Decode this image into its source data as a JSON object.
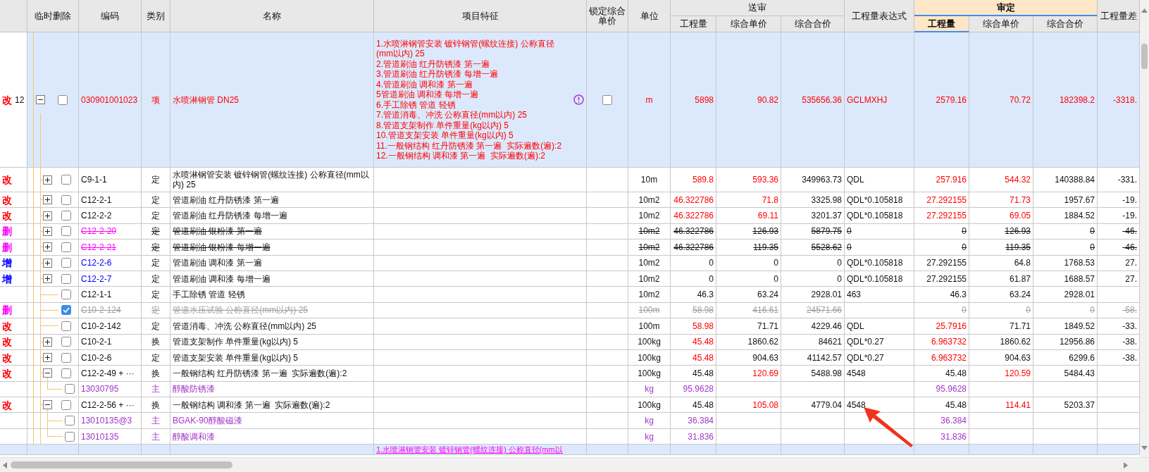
{
  "columns": [
    {
      "selected": false
    },
    {
      "label": "临时删除",
      "selected": false
    },
    {
      "label": "编码",
      "selected": false
    },
    {
      "label": "类别",
      "selected": false
    },
    {
      "label": "名称",
      "selected": false
    },
    {
      "label": "项目特征",
      "selected": false
    },
    {
      "label": "锁定综合单价",
      "selected": false
    },
    {
      "label": "单位",
      "selected": false
    },
    {
      "label": "送审",
      "selected": false,
      "children": [
        {
          "label": "工程量",
          "selected": false
        },
        {
          "label": "综合单价",
          "selected": false
        },
        {
          "label": "综合合价",
          "selected": false
        }
      ]
    },
    {
      "label": "工程量表达式",
      "selected": false
    },
    {
      "label": "审定",
      "selected": true,
      "children": [
        {
          "label": "工程量",
          "selected": true
        },
        {
          "label": "综合单价",
          "selected": false
        },
        {
          "label": "综合合价",
          "selected": false
        }
      ]
    },
    {
      "label": "工程量差",
      "selected": false
    }
  ],
  "rows": [
    {
      "kind": "item",
      "status": {
        "text": "改",
        "color": "#ff0000"
      },
      "line_no": "12",
      "expanded": true,
      "checked": false,
      "struck": false,
      "code": "030901001023",
      "type": "项",
      "name": "水喷淋钢管 DN25",
      "features": [
        "1.水喷淋钢管安装 镀锌钢管(螺纹连接) 公称直径(mm以内) 25",
        "2.管道刷油 红丹防锈漆 第一遍",
        "3.管道刷油 红丹防锈漆 每增一遍",
        "4.管道刷油 调和漆 第一遍",
        "5管道刷油 调和漆 每增一遍",
        "6.手工除锈 管道 轻锈",
        "7.管道消毒、冲洗 公称直径(mm以内) 25",
        "8.管道支架制作 单件重量(kg以内) 5",
        "10.管道支架安装 单件重量(kg以内) 5",
        "11.一般钢结构 红丹防锈漆 第一遍  实际遍数(遍):2",
        "12.一般钢结构 调和漆 第一遍  实际遍数(遍):2"
      ],
      "warning": true,
      "locked": false,
      "unit": "m",
      "sub_qty": {
        "text": "5898",
        "changed": true
      },
      "sub_price": {
        "text": "90.82",
        "changed": true
      },
      "sub_total": {
        "text": "535656.36",
        "changed": true
      },
      "expression": {
        "text": "GCLMXHJ",
        "changed": true
      },
      "app_qty": {
        "text": "2579.16",
        "changed": true
      },
      "app_price": {
        "text": "70.72",
        "changed": true
      },
      "app_total": {
        "text": "182398.2",
        "changed": true
      },
      "diff": {
        "text": "-3318.",
        "changed": true
      },
      "children": [
        {
          "kind": "quota",
          "status": {
            "text": "改",
            "color": "#ff0000"
          },
          "expanded": false,
          "checked": false,
          "struck": false,
          "code": "C9-1-1",
          "type": "定",
          "name": "水喷淋钢管安装 镀锌钢管(螺纹连接) 公称直径(mm以内) 25",
          "unit": "10m",
          "sub_qty": {
            "text": "589.8",
            "changed": true
          },
          "sub_price": {
            "text": "593.36",
            "changed": true
          },
          "sub_total": {
            "text": "349963.73",
            "changed": false
          },
          "expression": {
            "text": "QDL",
            "changed": false
          },
          "app_qty": {
            "text": "257.916",
            "changed": true
          },
          "app_price": {
            "text": "544.32",
            "changed": true
          },
          "app_total": {
            "text": "140388.84",
            "changed": false
          },
          "diff": {
            "text": "-331.",
            "changed": false
          }
        },
        {
          "kind": "quota",
          "status": {
            "text": "改",
            "color": "#ff0000"
          },
          "expanded": false,
          "checked": false,
          "struck": false,
          "code": "C12-2-1",
          "type": "定",
          "name": "管道刷油 红丹防锈漆 第一遍",
          "unit": "10m2",
          "sub_qty": {
            "text": "46.322786",
            "changed": true
          },
          "sub_price": {
            "text": "71.8",
            "changed": true
          },
          "sub_total": {
            "text": "3325.98",
            "changed": false
          },
          "expression": {
            "text": "QDL*0.105818",
            "changed": false
          },
          "app_qty": {
            "text": "27.292155",
            "changed": true
          },
          "app_price": {
            "text": "71.73",
            "changed": true
          },
          "app_total": {
            "text": "1957.67",
            "changed": false
          },
          "diff": {
            "text": "-19.",
            "changed": false
          }
        },
        {
          "kind": "quota",
          "status": {
            "text": "改",
            "color": "#ff0000"
          },
          "expanded": false,
          "checked": false,
          "struck": false,
          "code": "C12-2-2",
          "type": "定",
          "name": "管道刷油 红丹防锈漆 每增一遍",
          "unit": "10m2",
          "sub_qty": {
            "text": "46.322786",
            "changed": true
          },
          "sub_price": {
            "text": "69.11",
            "changed": true
          },
          "sub_total": {
            "text": "3201.37",
            "changed": false
          },
          "expression": {
            "text": "QDL*0.105818",
            "changed": false
          },
          "app_qty": {
            "text": "27.292155",
            "changed": true
          },
          "app_price": {
            "text": "69.05",
            "changed": true
          },
          "app_total": {
            "text": "1884.52",
            "changed": false
          },
          "diff": {
            "text": "-19.",
            "changed": false
          }
        },
        {
          "kind": "quota",
          "status": {
            "text": "删",
            "color": "#ff00ff"
          },
          "expanded": false,
          "checked": false,
          "struck": true,
          "code": {
            "text": "C12-2-20",
            "color": "#ff00ff"
          },
          "type": "定",
          "name": "管道刷油 银粉漆 第一遍",
          "unit": "10m2",
          "sub_qty": {
            "text": "46.322786",
            "changed": false
          },
          "sub_price": {
            "text": "126.93",
            "changed": false
          },
          "sub_total": {
            "text": "5879.75",
            "changed": false
          },
          "expression": {
            "text": "0",
            "changed": false
          },
          "app_qty": {
            "text": "0",
            "changed": false
          },
          "app_price": {
            "text": "126.93",
            "changed": false
          },
          "app_total": {
            "text": "0",
            "changed": false
          },
          "diff": {
            "text": "-46.",
            "changed": false
          }
        },
        {
          "kind": "quota",
          "status": {
            "text": "删",
            "color": "#ff00ff"
          },
          "expanded": false,
          "checked": false,
          "struck": true,
          "code": {
            "text": "C12-2-21",
            "color": "#ff00ff"
          },
          "type": "定",
          "name": "管道刷油 银粉漆 每增一遍",
          "unit": "10m2",
          "sub_qty": {
            "text": "46.322786",
            "changed": false
          },
          "sub_price": {
            "text": "119.35",
            "changed": false
          },
          "sub_total": {
            "text": "5528.62",
            "changed": false
          },
          "expression": {
            "text": "0",
            "changed": false
          },
          "app_qty": {
            "text": "0",
            "changed": false
          },
          "app_price": {
            "text": "119.35",
            "changed": false
          },
          "app_total": {
            "text": "0",
            "changed": false
          },
          "diff": {
            "text": "-46.",
            "changed": false
          }
        },
        {
          "kind": "quota",
          "status": {
            "text": "增",
            "color": "#0000ff"
          },
          "expanded": false,
          "checked": false,
          "struck": false,
          "code": {
            "text": "C12-2-6",
            "color": "#0000ff"
          },
          "type": "定",
          "name": "管道刷油 调和漆 第一遍",
          "unit": "10m2",
          "sub_qty": {
            "text": "0",
            "changed": false
          },
          "sub_price": {
            "text": "0",
            "changed": false
          },
          "sub_total": {
            "text": "0",
            "changed": false
          },
          "expression": {
            "text": "QDL*0.105818",
            "changed": false
          },
          "app_qty": {
            "text": "27.292155",
            "changed": false
          },
          "app_price": {
            "text": "64.8",
            "changed": false
          },
          "app_total": {
            "text": "1768.53",
            "changed": false
          },
          "diff": {
            "text": "27.",
            "changed": false
          }
        },
        {
          "kind": "quota",
          "status": {
            "text": "增",
            "color": "#0000ff"
          },
          "expanded": false,
          "checked": false,
          "struck": false,
          "code": {
            "text": "C12-2-7",
            "color": "#0000ff"
          },
          "type": "定",
          "name": "管道刷油 调和漆 每增一遍",
          "unit": "10m2",
          "sub_qty": {
            "text": "0",
            "changed": false
          },
          "sub_price": {
            "text": "0",
            "changed": false
          },
          "sub_total": {
            "text": "0",
            "changed": false
          },
          "expression": {
            "text": "QDL*0.105818",
            "changed": false
          },
          "app_qty": {
            "text": "27.292155",
            "changed": false
          },
          "app_price": {
            "text": "61.87",
            "changed": false
          },
          "app_total": {
            "text": "1688.57",
            "changed": false
          },
          "diff": {
            "text": "27.",
            "changed": false
          }
        },
        {
          "kind": "quota",
          "checked": false,
          "struck": false,
          "code": "C12-1-1",
          "type": "定",
          "name": "手工除锈 管道 轻锈",
          "unit": "10m2",
          "sub_qty": {
            "text": "46.3",
            "changed": false
          },
          "sub_price": {
            "text": "63.24",
            "changed": false
          },
          "sub_total": {
            "text": "2928.01",
            "changed": false
          },
          "expression": {
            "text": "463",
            "changed": false
          },
          "app_qty": {
            "text": "46.3",
            "changed": false
          },
          "app_price": {
            "text": "63.24",
            "changed": false
          },
          "app_total": {
            "text": "2928.01",
            "changed": false
          }
        },
        {
          "kind": "quota",
          "status": {
            "text": "删",
            "color": "#ff00ff"
          },
          "checked": true,
          "struck": true,
          "code": "C10-2-124",
          "type": "定",
          "name": "管道水压试验 公称直径(mm以内) 25",
          "unit": "100m",
          "sub_qty": {
            "text": "58.98",
            "changed": false
          },
          "sub_price": {
            "text": "416.61",
            "changed": false
          },
          "sub_total": {
            "text": "24571.66",
            "changed": false
          },
          "app_qty": {
            "text": "0",
            "changed": false
          },
          "app_price": {
            "text": "0",
            "changed": false
          },
          "app_total": {
            "text": "0",
            "changed": false
          },
          "diff": {
            "text": "-58.",
            "changed": false
          }
        },
        {
          "kind": "quota",
          "status": {
            "text": "改",
            "color": "#ff0000"
          },
          "checked": false,
          "struck": false,
          "code": "C10-2-142",
          "type": "定",
          "name": "管道消毒、冲洗 公称直径(mm以内) 25",
          "unit": "100m",
          "sub_qty": {
            "text": "58.98",
            "changed": true
          },
          "sub_price": {
            "text": "71.71",
            "changed": false
          },
          "sub_total": {
            "text": "4229.46",
            "changed": false
          },
          "expression": {
            "text": "QDL",
            "changed": false
          },
          "app_qty": {
            "text": "25.7916",
            "changed": true
          },
          "app_price": {
            "text": "71.71",
            "changed": false
          },
          "app_total": {
            "text": "1849.52",
            "changed": false
          },
          "diff": {
            "text": "-33.",
            "changed": false
          }
        },
        {
          "kind": "quota",
          "status": {
            "text": "改",
            "color": "#ff0000"
          },
          "expanded": false,
          "checked": false,
          "struck": false,
          "code": "C10-2-1",
          "type": "换",
          "name": "管道支架制作 单件重量(kg以内) 5",
          "unit": "100kg",
          "sub_qty": {
            "text": "45.48",
            "changed": true
          },
          "sub_price": {
            "text": "1860.62",
            "changed": false
          },
          "sub_total": {
            "text": "84621",
            "changed": false
          },
          "expression": {
            "text": "QDL*0.27",
            "changed": false
          },
          "app_qty": {
            "text": "6.963732",
            "changed": true
          },
          "app_price": {
            "text": "1860.62",
            "changed": false
          },
          "app_total": {
            "text": "12956.86",
            "changed": false
          },
          "diff": {
            "text": "-38.",
            "changed": false
          }
        },
        {
          "kind": "quota",
          "status": {
            "text": "改",
            "color": "#ff0000"
          },
          "expanded": false,
          "checked": false,
          "struck": false,
          "code": "C10-2-6",
          "type": "定",
          "name": "管道支架安装 单件重量(kg以内) 5",
          "unit": "100kg",
          "sub_qty": {
            "text": "45.48",
            "changed": true
          },
          "sub_price": {
            "text": "904.63",
            "changed": false
          },
          "sub_total": {
            "text": "41142.57",
            "changed": false
          },
          "expression": {
            "text": "QDL*0.27",
            "changed": false
          },
          "app_qty": {
            "text": "6.963732",
            "changed": true
          },
          "app_price": {
            "text": "904.63",
            "changed": false
          },
          "app_total": {
            "text": "6299.6",
            "changed": false
          },
          "diff": {
            "text": "-38.",
            "changed": false
          }
        },
        {
          "kind": "quota",
          "status": {
            "text": "改",
            "color": "#ff0000"
          },
          "expanded": true,
          "checked": false,
          "struck": false,
          "code": "C12-2-49 + ···",
          "type": "换",
          "name": "一般钢结构 红丹防锈漆 第一遍  实际遍数(遍):2",
          "unit": "100kg",
          "sub_qty": {
            "text": "45.48",
            "changed": false
          },
          "sub_price": {
            "text": "120.69",
            "changed": true
          },
          "sub_total": {
            "text": "5488.98",
            "changed": false
          },
          "expression": {
            "text": "4548",
            "changed": false
          },
          "app_qty": {
            "text": "45.48",
            "changed": false
          },
          "app_price": {
            "text": "120.59",
            "changed": true
          },
          "app_total": {
            "text": "5484.43",
            "changed": false
          },
          "children": [
            {
              "kind": "material",
              "checked": false,
              "struck": false,
              "code": "13030795",
              "type": "主",
              "name": "醇酸防锈漆",
              "unit": "kg",
              "sub_qty": {
                "text": "95.9628",
                "changed": false
              },
              "app_qty": {
                "text": "95.9628",
                "changed": false
              }
            }
          ]
        },
        {
          "kind": "quota",
          "status": {
            "text": "改",
            "color": "#ff0000"
          },
          "expanded": true,
          "checked": false,
          "struck": false,
          "code": "C12-2-56 + ···",
          "type": "换",
          "name": "一般钢结构 调和漆 第一遍  实际遍数(遍):2",
          "unit": "100kg",
          "sub_qty": {
            "text": "45.48",
            "changed": false
          },
          "sub_price": {
            "text": "105.08",
            "changed": true
          },
          "sub_total": {
            "text": "4779.04",
            "changed": false
          },
          "expression": {
            "text": "4548",
            "changed": false
          },
          "app_qty": {
            "text": "45.48",
            "changed": false
          },
          "app_price": {
            "text": "114.41",
            "changed": true
          },
          "app_total": {
            "text": "5203.37",
            "changed": false
          },
          "children": [
            {
              "kind": "material",
              "checked": false,
              "struck": false,
              "code": "13010135@3",
              "type": "主",
              "name": "BGAK-90醇酸磁漆",
              "unit": "kg",
              "sub_qty": {
                "text": "36.384",
                "changed": false
              },
              "app_qty": {
                "text": "36.384",
                "changed": false
              }
            },
            {
              "kind": "material",
              "checked": false,
              "struck": false,
              "code": "13010135",
              "type": "主",
              "name": "醇酸调和漆",
              "unit": "kg",
              "sub_qty": {
                "text": "31.836",
                "changed": false
              },
              "app_qty": {
                "text": "31.836",
                "changed": false
              }
            }
          ]
        }
      ]
    }
  ],
  "next_row": {
    "features": "1.水喷淋钢管安装 镀锌钢管(螺纹连接) 公称直径(mm以"
  }
}
